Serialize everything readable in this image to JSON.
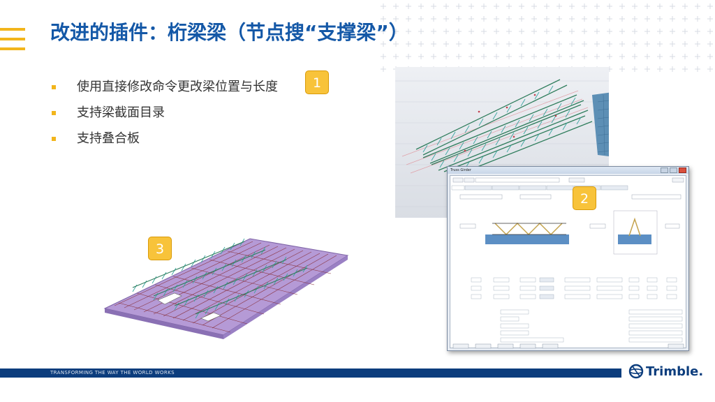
{
  "slide": {
    "title": "改进的插件：桁梁梁（节点搜“支撑梁”）",
    "bullets": [
      "使用直接修改命令更改梁位置与长度",
      "支持梁截面目录",
      "支持叠合板"
    ],
    "badges": [
      "1",
      "2",
      "3"
    ]
  },
  "footer": {
    "tagline": "TRANSFORMING THE WAY THE WORLD WORKS",
    "logo": "Trimble."
  },
  "dialog": {
    "title": "Truss Girder",
    "window_buttons": [
      "minimize-icon",
      "maximize-icon",
      "close-icon"
    ]
  },
  "colors": {
    "title_blue": "#1458a7",
    "accent_yellow": "#f2b51c",
    "footer_navy": "#0c3d7d",
    "slab_purple": "#b59ad6",
    "truss_teal": "#3aa6a0",
    "rebar_red": "#b6413b",
    "wall_blue": "#5d8fb5"
  }
}
